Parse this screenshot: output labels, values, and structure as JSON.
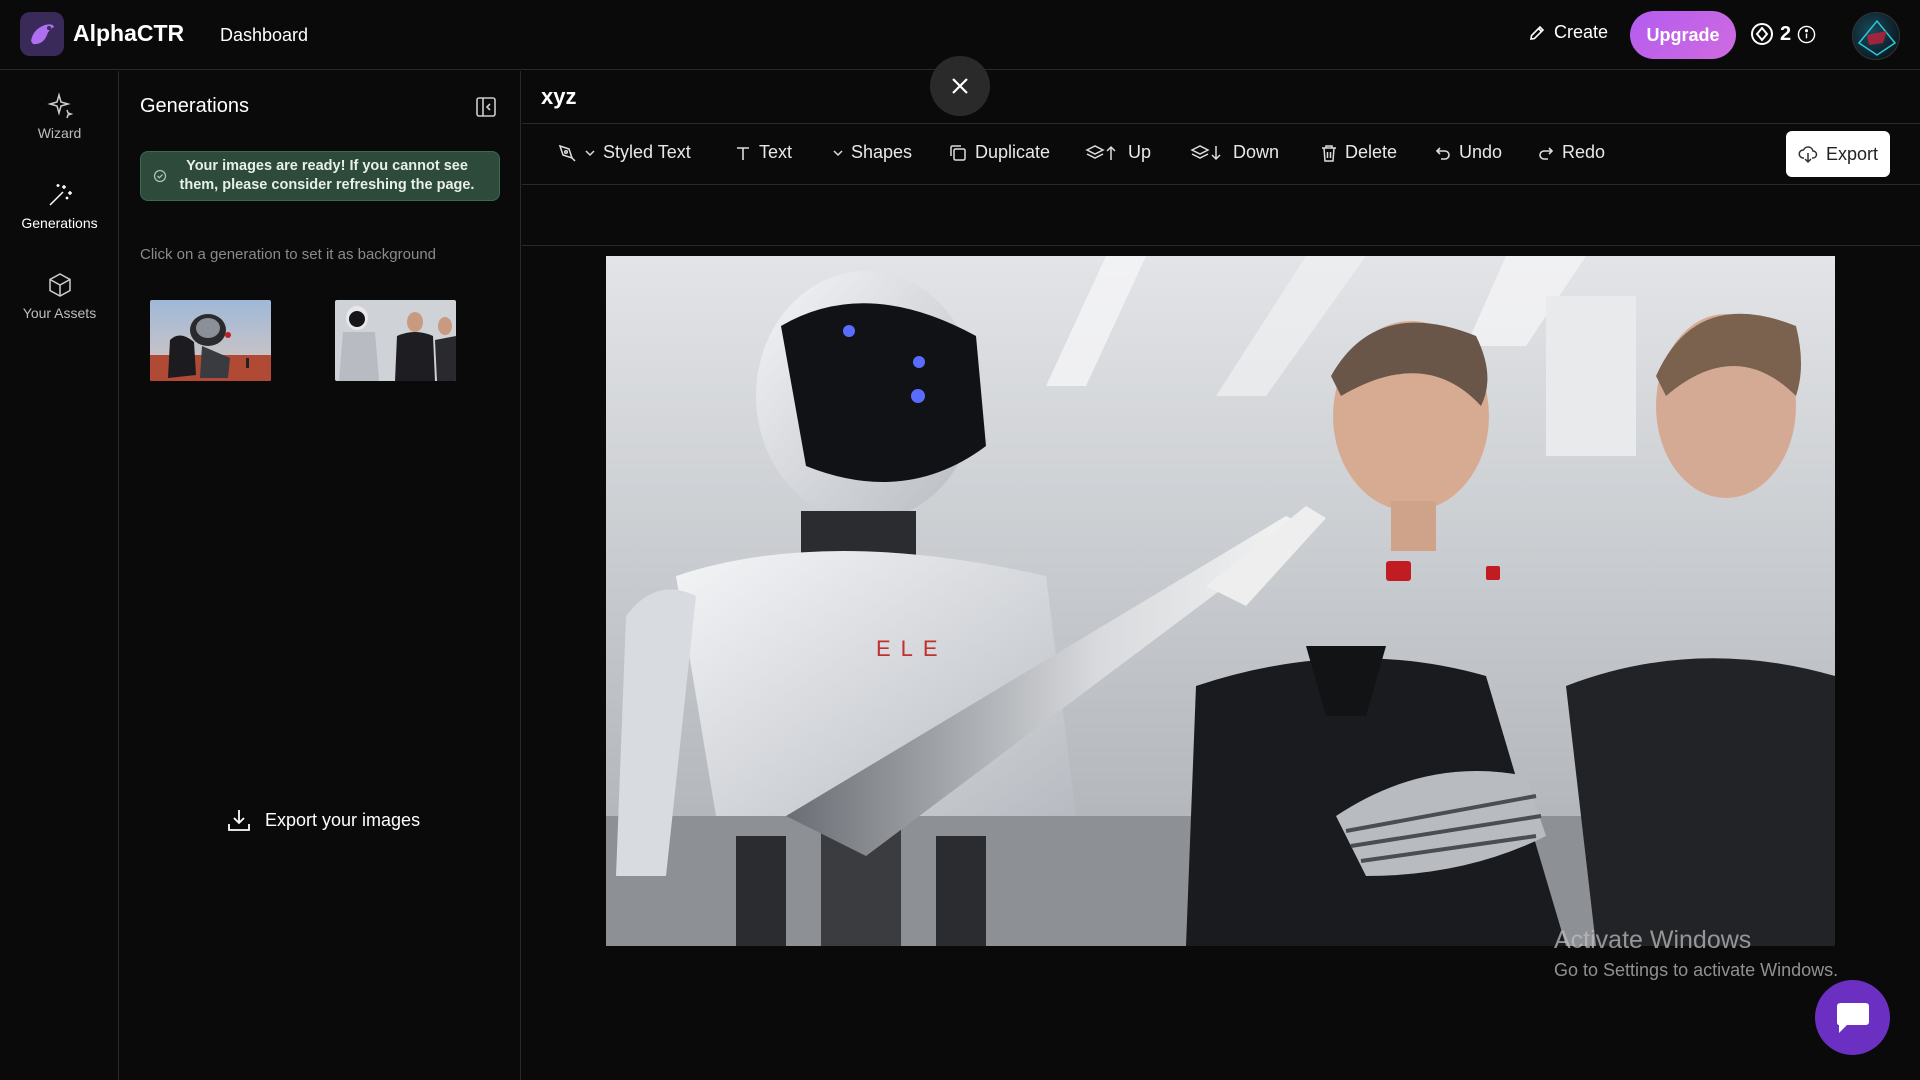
{
  "header": {
    "brand": "AlphaCTR",
    "nav_dashboard": "Dashboard",
    "create_label": "Create",
    "upgrade_label": "Upgrade",
    "credits": "2"
  },
  "rail": {
    "items": [
      {
        "label": "Wizard",
        "icon": "sparkle-icon"
      },
      {
        "label": "Generations",
        "icon": "magic-wand-icon",
        "active": true
      },
      {
        "label": "Your Assets",
        "icon": "cube-icon"
      }
    ]
  },
  "panel": {
    "title": "Generations",
    "alert": "Your images are ready! If you cannot see them, please consider refreshing the page.",
    "hint": "Click on a generation to set it as background",
    "export_label": "Export your images"
  },
  "canvas": {
    "title": "xyz"
  },
  "toolbar": {
    "styled_text": "Styled Text",
    "text": "Text",
    "shapes": "Shapes",
    "duplicate": "Duplicate",
    "up": "Up",
    "down": "Down",
    "delete": "Delete",
    "undo": "Undo",
    "redo": "Redo",
    "export": "Export"
  },
  "image": {
    "robot_chest_text": "ELE"
  },
  "watermark": {
    "line1": "Activate Windows",
    "line2": "Go to Settings to activate Windows."
  },
  "colors": {
    "upgrade_gradient_start": "#b45cf0",
    "upgrade_gradient_end": "#d06be0",
    "alert_bg": "#2d4a3a",
    "chat_bubble": "#6b2fc2",
    "background": "#0a0a0a"
  }
}
